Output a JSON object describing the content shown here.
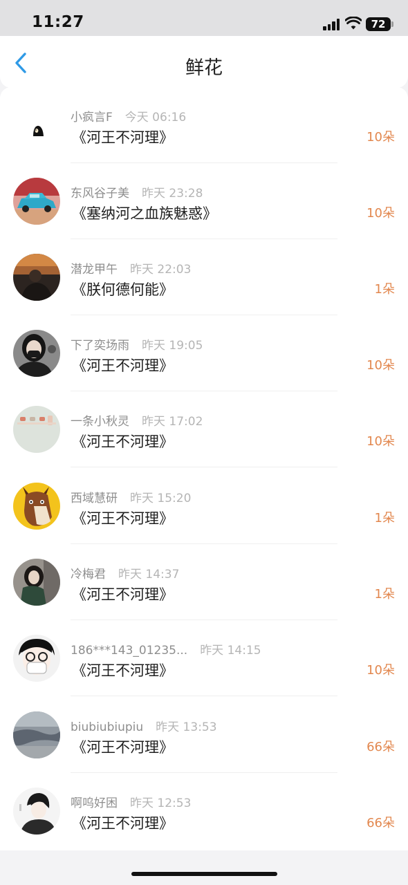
{
  "status_bar": {
    "time": "11:27",
    "battery": "72"
  },
  "header": {
    "title": "鲜花"
  },
  "items": [
    {
      "user": "小疯言F",
      "time": "今天 06:16",
      "book": "《河王不河理》",
      "amount": "10朵"
    },
    {
      "user": "东风谷子美",
      "time": "昨天 23:28",
      "book": "《塞纳河之血族魅惑》",
      "amount": "10朵"
    },
    {
      "user": "潜龙甲午",
      "time": "昨天 22:03",
      "book": "《朕何德何能》",
      "amount": "1朵"
    },
    {
      "user": "下了奕场雨",
      "time": "昨天 19:05",
      "book": "《河王不河理》",
      "amount": "10朵"
    },
    {
      "user": "一条小秋灵",
      "time": "昨天 17:02",
      "book": "《河王不河理》",
      "amount": "10朵"
    },
    {
      "user": "西域慧研",
      "time": "昨天 15:20",
      "book": "《河王不河理》",
      "amount": "1朵"
    },
    {
      "user": "冷梅君",
      "time": "昨天 14:37",
      "book": "《河王不河理》",
      "amount": "1朵"
    },
    {
      "user": "186***143_01235...",
      "time": "昨天 14:15",
      "book": "《河王不河理》",
      "amount": "10朵"
    },
    {
      "user": "biubiubiupiu",
      "time": "昨天 13:53",
      "book": "《河王不河理》",
      "amount": "66朵"
    },
    {
      "user": "啊呜好困",
      "time": "昨天 12:53",
      "book": "《河王不河理》",
      "amount": "66朵"
    }
  ],
  "colors": {
    "accent": "#e2874e",
    "back_arrow": "#2f9ae6"
  }
}
